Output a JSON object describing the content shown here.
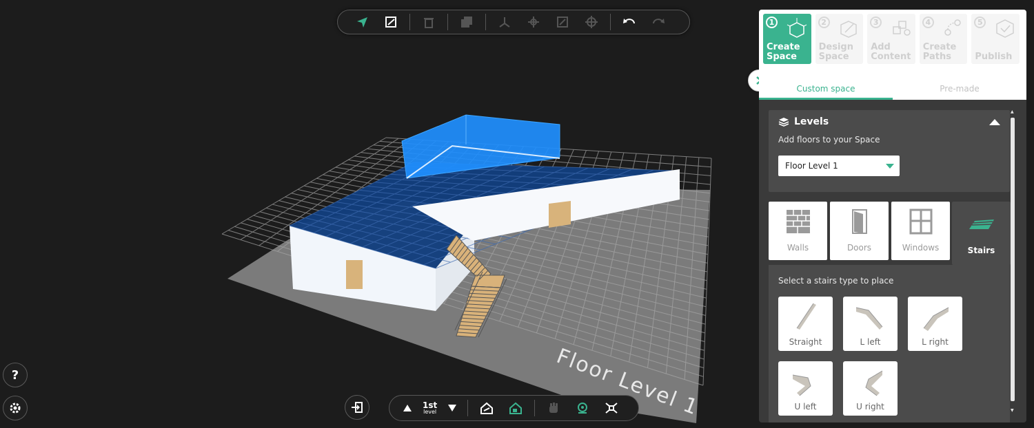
{
  "viewport": {
    "floor_label": "Floor Level 1",
    "accent": "#3ab38f",
    "selection_color": "#1e90ff"
  },
  "top_toolbar": {
    "tools": [
      "select-arrow-icon",
      "draw-polygon-icon",
      "delete-icon",
      "duplicate-icon",
      "move-axes-icon",
      "move-icon",
      "scale-icon",
      "rotate-icon",
      "undo-icon",
      "redo-icon"
    ]
  },
  "bottom_toolbar": {
    "level_number": "1st",
    "level_word": "level",
    "tools": [
      "level-up-icon",
      "level-down-icon",
      "view-house-icon",
      "view-floor-icon",
      "hand-icon",
      "camera-icon",
      "drone-icon"
    ]
  },
  "left_buttons": {
    "help": "?",
    "settings": "gear"
  },
  "steps": [
    {
      "num": "1",
      "label_line1": "Create",
      "label_line2": "Space",
      "active": true
    },
    {
      "num": "2",
      "label_line1": "Design",
      "label_line2": "Space",
      "active": false
    },
    {
      "num": "3",
      "label_line1": "Add",
      "label_line2": "Content",
      "active": false
    },
    {
      "num": "4",
      "label_line1": "Create",
      "label_line2": "Paths",
      "active": false
    },
    {
      "num": "5",
      "label_line1": "",
      "label_line2": "Publish",
      "active": false
    }
  ],
  "tabs": [
    {
      "label": "Custom space",
      "active": true
    },
    {
      "label": "Pre-made",
      "active": false
    }
  ],
  "levels": {
    "title": "Levels",
    "subtitle": "Add floors to your Space",
    "selected": "Floor Level 1"
  },
  "categories": [
    {
      "label": "Walls",
      "active": false
    },
    {
      "label": "Doors",
      "active": false
    },
    {
      "label": "Windows",
      "active": false
    },
    {
      "label": "Stairs",
      "active": true
    }
  ],
  "stairs": {
    "subtitle": "Select a stairs type to place",
    "types": [
      "Straight",
      "L left",
      "L right",
      "U left",
      "U right"
    ]
  }
}
